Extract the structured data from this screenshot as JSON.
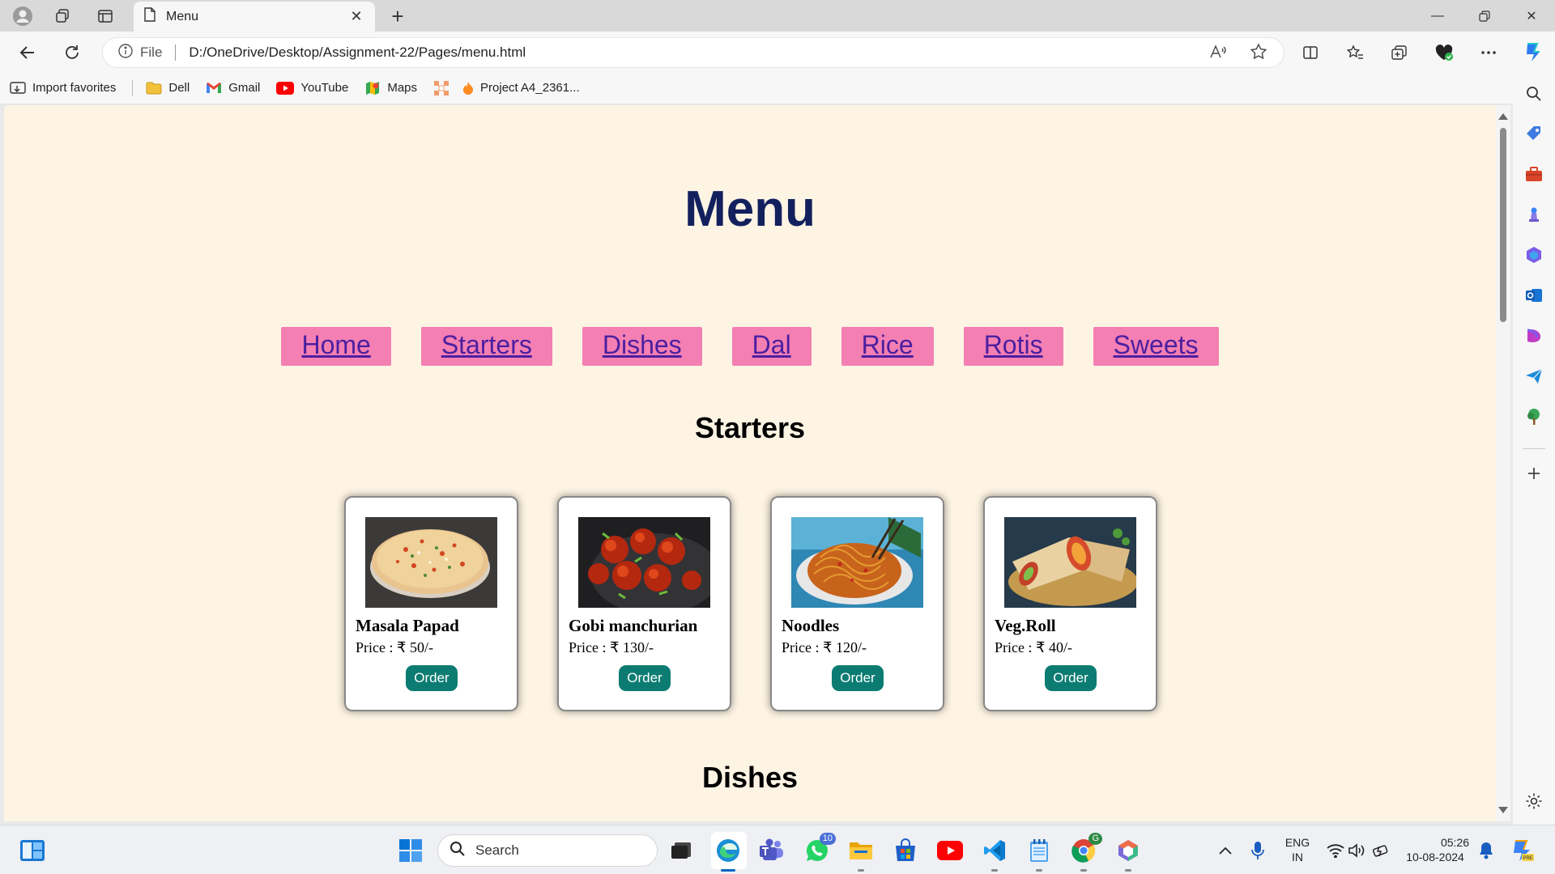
{
  "browser": {
    "tab_title": "Menu",
    "address": {
      "scheme_label": "File",
      "url": "D:/OneDrive/Desktop/Assignment-22/Pages/menu.html"
    },
    "favorites": [
      {
        "label": "Import favorites",
        "icon": "import-icon"
      },
      {
        "label": "Dell",
        "icon": "folder-icon"
      },
      {
        "label": "Gmail",
        "icon": "gmail-icon"
      },
      {
        "label": "YouTube",
        "icon": "youtube-icon"
      },
      {
        "label": "Maps",
        "icon": "maps-icon"
      },
      {
        "label": "",
        "icon": "app-grid-icon"
      },
      {
        "label": "Project A4_2361...",
        "icon": "fire-icon"
      }
    ]
  },
  "page": {
    "title": "Menu",
    "nav": [
      "Home",
      "Starters",
      "Dishes",
      "Dal",
      "Rice",
      "Rotis",
      "Sweets"
    ],
    "sections": [
      {
        "title": "Starters",
        "items": [
          {
            "name": "Masala Papad",
            "price": "Price : ₹ 50/-",
            "button": "Order"
          },
          {
            "name": "Gobi manchurian",
            "price": "Price : ₹ 130/-",
            "button": "Order"
          },
          {
            "name": "Noodles",
            "price": "Price : ₹ 120/-",
            "button": "Order"
          },
          {
            "name": "Veg.Roll",
            "price": "Price : ₹ 40/-",
            "button": "Order"
          }
        ]
      },
      {
        "title": "Dishes"
      }
    ],
    "colors": {
      "background": "#fdf4e4",
      "title": "#13205e",
      "nav_button": "#f47fb3",
      "nav_link": "#4b1fa0",
      "order_button": "#0c7c72"
    }
  },
  "taskbar": {
    "search_placeholder": "Search",
    "whatsapp_badge": "10",
    "chrome_badge": "G",
    "language": "ENG",
    "region": "IN",
    "time": "05:26",
    "date": "10-08-2024"
  }
}
